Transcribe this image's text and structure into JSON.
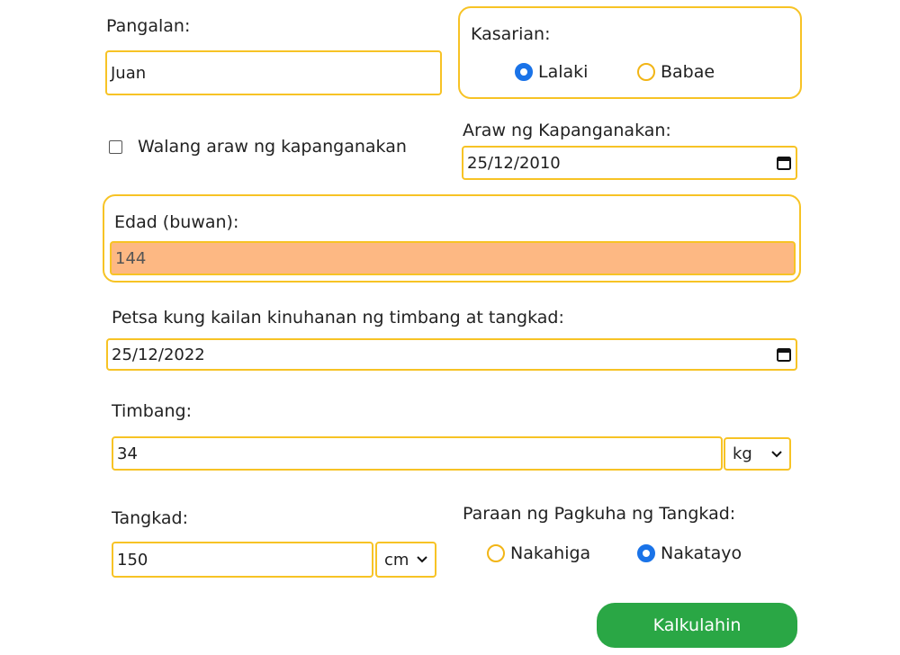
{
  "name": {
    "label": "Pangalan:",
    "value": "Juan"
  },
  "sex": {
    "label": "Kasarian:",
    "options": [
      {
        "label": "Lalaki",
        "selected": true
      },
      {
        "label": "Babae",
        "selected": false
      }
    ]
  },
  "no_birthdate": {
    "label": "Walang araw ng kapanganakan",
    "checked": false
  },
  "birthdate": {
    "label": "Araw ng Kapanganakan:",
    "value": "25/12/2010"
  },
  "age": {
    "label": "Edad (buwan):",
    "value": "144"
  },
  "measure_date": {
    "label": "Petsa kung kailan kinuhanan ng timbang at tangkad:",
    "value": "25/12/2022"
  },
  "weight": {
    "label": "Timbang:",
    "value": "34",
    "unit": "kg"
  },
  "height": {
    "label": "Tangkad:",
    "value": "150",
    "unit": "cm"
  },
  "height_method": {
    "label": "Paraan ng Pagkuha ng Tangkad:",
    "options": [
      {
        "label": "Nakahiga",
        "selected": false
      },
      {
        "label": "Nakatayo",
        "selected": true
      }
    ]
  },
  "submit": {
    "label": "Kalkulahin"
  },
  "colors": {
    "accent": "#f7c325",
    "age_bg": "#fdb883",
    "radio_on": "#1a73e8",
    "button": "#2aa745"
  }
}
